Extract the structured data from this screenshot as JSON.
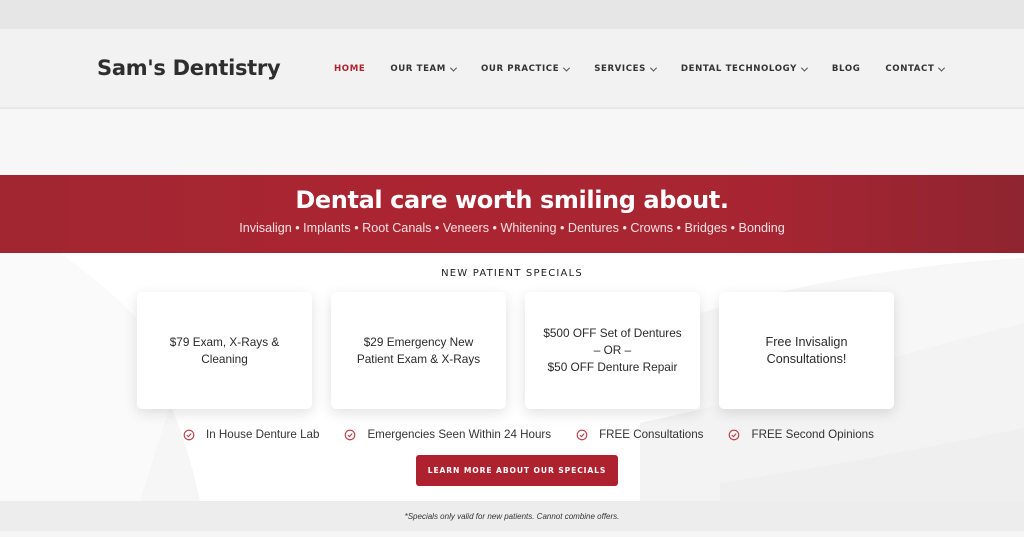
{
  "header": {
    "logo": "Sam's Dentistry",
    "nav": [
      {
        "label": "HOME",
        "active": true,
        "dropdown": false
      },
      {
        "label": "OUR TEAM",
        "active": false,
        "dropdown": true
      },
      {
        "label": "OUR PRACTICE",
        "active": false,
        "dropdown": true
      },
      {
        "label": "SERVICES",
        "active": false,
        "dropdown": true
      },
      {
        "label": "DENTAL TECHNOLOGY",
        "active": false,
        "dropdown": true
      },
      {
        "label": "BLOG",
        "active": false,
        "dropdown": false
      },
      {
        "label": "CONTACT",
        "active": false,
        "dropdown": true
      }
    ]
  },
  "hero": {
    "title": "Dental care worth smiling about.",
    "subtitle": "Invisalign • Implants • Root Canals • Veneers • Whitening • Dentures • Crowns • Bridges • Bonding"
  },
  "specials": {
    "heading": "NEW PATIENT SPECIALS",
    "cards": [
      {
        "text": "$79 Exam, X-Rays &\nCleaning"
      },
      {
        "text": "$29 Emergency New\nPatient Exam & X-Rays"
      },
      {
        "text": "$500 OFF Set of Dentures\n– OR –\n$50 OFF Denture Repair"
      },
      {
        "text": "Free Invisalign\nConsultations!"
      }
    ],
    "features": [
      {
        "icon": "check-circle-icon",
        "label": "In House Denture Lab"
      },
      {
        "icon": "check-circle-icon",
        "label": "Emergencies Seen Within 24 Hours"
      },
      {
        "icon": "check-circle-icon",
        "label": "FREE Consultations"
      },
      {
        "icon": "check-circle-icon",
        "label": "FREE Second Opinions"
      }
    ],
    "cta_label": "LEARN MORE ABOUT OUR SPECIALS",
    "disclaimer": "*Specials only valid for new patients. Cannot combine offers."
  },
  "colors": {
    "brand_red": "#ae2230",
    "hero_red": "#a72532",
    "text_dark": "#2e2e2e"
  }
}
